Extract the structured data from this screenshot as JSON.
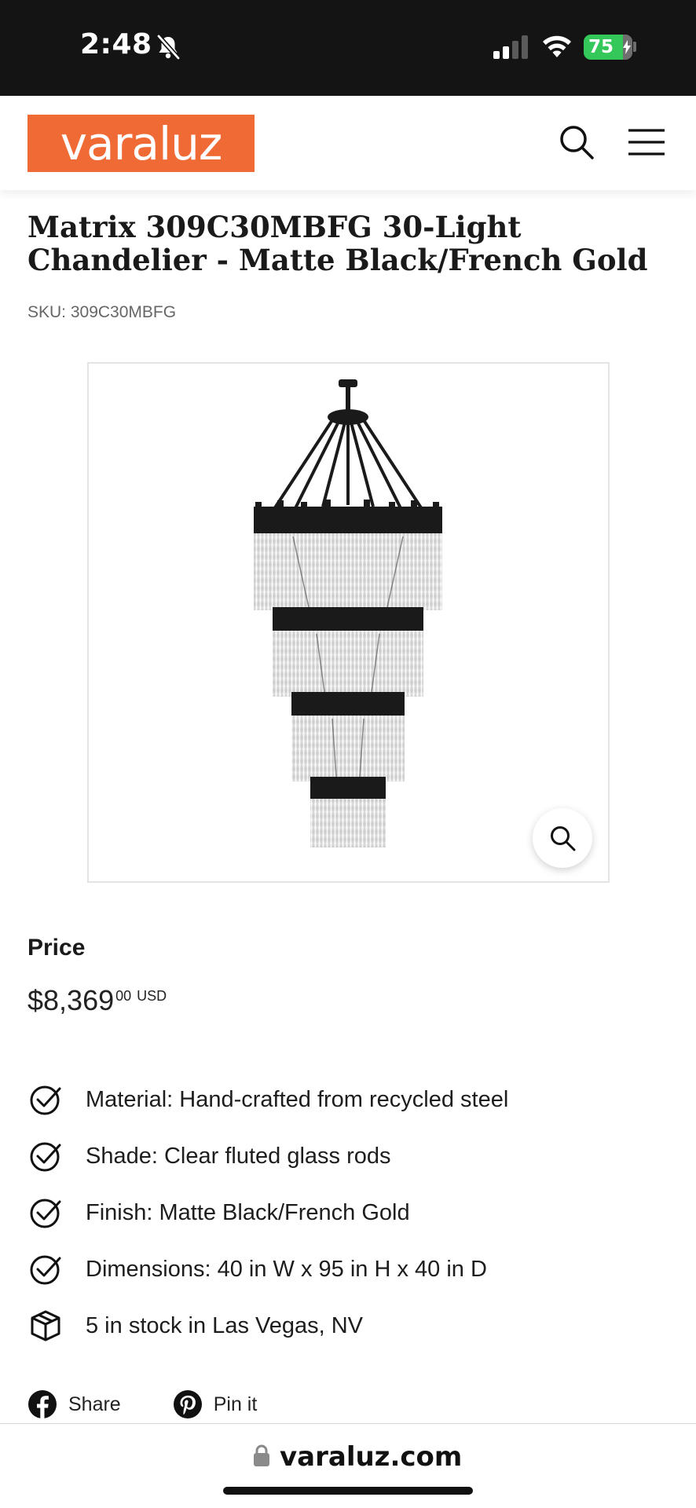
{
  "status_bar": {
    "time": "2:48",
    "battery_level": "75"
  },
  "header": {
    "logo_text": "varaluz",
    "brand_color": "#f06a35"
  },
  "product": {
    "title": "Matrix 309C30MBFG 30-Light Chandelier - Matte Black/French Gold",
    "sku": "SKU: 309C30MBFG",
    "image_alt": "Matrix 309C30MBFG 30-Light Chandelier"
  },
  "price": {
    "label": "Price",
    "amount": "$8,369",
    "cents": "00",
    "currency": "USD"
  },
  "features": [
    {
      "icon": "check-circle-icon",
      "text": "Material: Hand-crafted from recycled steel"
    },
    {
      "icon": "check-circle-icon",
      "text": "Shade: Clear fluted glass rods"
    },
    {
      "icon": "check-circle-icon",
      "text": "Finish: Matte Black/French Gold"
    },
    {
      "icon": "check-circle-icon",
      "text": "Dimensions: 40 in W x 95 in H x 40 in D"
    },
    {
      "icon": "box-icon",
      "text": "5 in stock in Las Vegas, NV"
    }
  ],
  "share": {
    "facebook_label": "Share",
    "pinterest_label": "Pin it"
  },
  "browser": {
    "url": "varaluz.com"
  }
}
